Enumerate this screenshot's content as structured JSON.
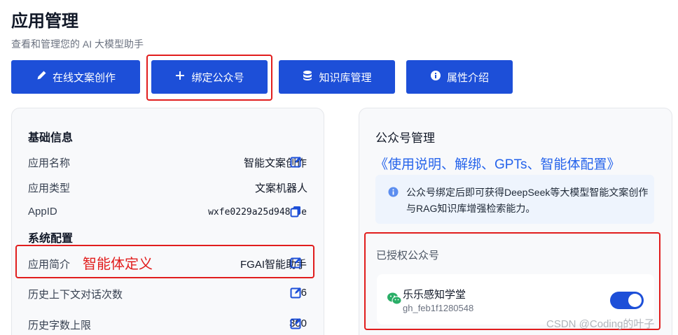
{
  "header": {
    "title": "应用管理",
    "subtitle": "查看和管理您的 AI 大模型助手"
  },
  "toolbar": {
    "buttons": [
      {
        "label": "在线文案创作",
        "icon": "pen-icon"
      },
      {
        "label": "绑定公众号",
        "icon": "plus-icon"
      },
      {
        "label": "知识库管理",
        "icon": "database-icon"
      },
      {
        "label": "属性介绍",
        "icon": "info-icon"
      }
    ]
  },
  "basic_info": {
    "title": "基础信息",
    "rows": [
      {
        "label": "应用名称",
        "value": "智能文案创作"
      },
      {
        "label": "应用类型",
        "value": "文案机器人"
      },
      {
        "label": "AppID",
        "value": "wxfe0229a25d94863e"
      }
    ]
  },
  "system_config": {
    "title": "系统配置",
    "rows": [
      {
        "label": "应用简介",
        "value": "FGAI智能助手"
      },
      {
        "label": "历史上下文对话次数",
        "value": "6"
      },
      {
        "label": "历史字数上限",
        "value": "300"
      }
    ],
    "annotation": "智能体定义"
  },
  "official_account": {
    "title": "公众号管理",
    "link": "《使用说明、解绑、GPTs、智能体配置》",
    "info": "公众号绑定后即可获得DeepSeek等大模型智能文案创作与RAG知识库增强检索能力。",
    "authorized_title": "已授权公众号",
    "account": {
      "name": "乐乐感知学堂",
      "id": "gh_feb1f1280548",
      "enabled": true
    }
  },
  "watermark": "CSDN @Coding的叶子",
  "colors": {
    "primary": "#1d4fd8",
    "annotation_red": "#e11d1d",
    "link": "#2563eb"
  }
}
